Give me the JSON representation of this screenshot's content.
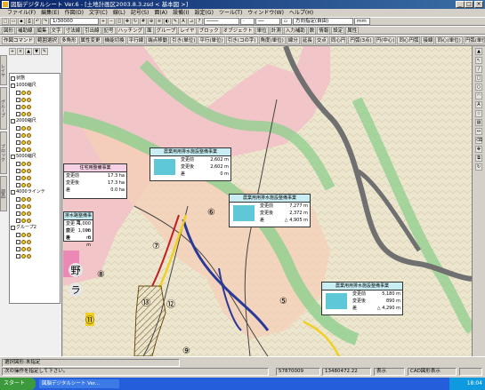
{
  "window": {
    "title": "図脳デジタルシート Ver.6 - [土地計画区2003.8.3.zsd  <  基本図  >]"
  },
  "menu": [
    "ファイル(F)",
    "編集(E)",
    "作図(D)",
    "文字(C)",
    "線(L)",
    "記号(S)",
    "面(A)",
    "設備(I)",
    "設定(G)",
    "ツール(T)",
    "ウィンドウ(W)",
    "ヘルプ(H)"
  ],
  "toolbar1": {
    "scale": "1/30000",
    "direction": "方向指定(自由)",
    "unit": "mm"
  },
  "toolbar2": [
    "図形",
    "補助線",
    "編集",
    "文字",
    "寸法線",
    "引出線",
    "記号",
    "ハッチング",
    "面",
    "グループ",
    "レイヤ",
    "ブロック",
    "オブジェクト",
    "単位",
    "計測",
    "入力補助",
    "数",
    "情報",
    "設定",
    "属性"
  ],
  "toolbar3": [
    "作図コマンド",
    "範囲選択",
    "多角形",
    "属性変更",
    "機能切換",
    "平行線",
    "端点移動",
    "引き(単位)",
    "平行(単位)",
    "引き(コの字)",
    "角度(単位)",
    "線分",
    "延長",
    "交点",
    "同心円",
    "円弧(3点)",
    "円(中心)",
    "同心円弧",
    "接線",
    "同心(単位)",
    "円弧(単位)",
    "同心円(延長)"
  ],
  "panel": {
    "tabs": [
      "レイヤ",
      "グループ",
      "ブロック",
      "部品"
    ],
    "tree": [
      {
        "label": "状態"
      },
      {
        "label": "1000縮尺"
      },
      {
        "label": "2000縮尺"
      },
      {
        "label": "5000縮尺"
      },
      {
        "label": "4000ラインテ"
      },
      {
        "label": "グループ2"
      }
    ]
  },
  "labels": {
    "box1": {
      "title": "住宅用整備事業",
      "rows": [
        [
          "変更前",
          "17.3 ha"
        ],
        [
          "変更後",
          "17.3 ha"
        ],
        [
          "差",
          "0.0 ha"
        ]
      ]
    },
    "box2": {
      "title": "農業用用排水施設整備事業",
      "rows": [
        [
          "変更前",
          "2,602 m"
        ],
        [
          "変更後",
          "2,602 m"
        ],
        [
          "差",
          "0 m"
        ]
      ]
    },
    "box3": {
      "title": "農業用用排水施設整備事業",
      "rows": [
        [
          "変更前",
          "7,277 m"
        ],
        [
          "変更後",
          "2,372 m"
        ],
        [
          "差",
          "△ 4,905 m"
        ]
      ]
    },
    "box4": {
      "title": "農業用用排水施設整備事業",
      "rows": [
        [
          "変更前",
          "5,180 m"
        ],
        [
          "変更後",
          "890 m"
        ],
        [
          "差",
          "△ 4,290 m"
        ]
      ]
    },
    "box5": {
      "title": "排水路整備事業",
      "rows": [
        [
          "変更前",
          "1,000 m"
        ],
        [
          "変更後",
          "1,000 m"
        ],
        [
          "差",
          "0 m"
        ]
      ]
    },
    "circles": [
      "⑤",
      "⑥",
      "⑦",
      "⑧",
      "⑨",
      "⑪",
      "⑫",
      "⑬"
    ],
    "place": [
      "野",
      "ラ"
    ]
  },
  "status": {
    "coord_label": "選択図形:未指定",
    "prompt": "次の操作を指定して下さい。",
    "x": "57870009",
    "y": "13480472.22",
    "grid": "表示",
    "snap": "CAD図形表示"
  },
  "taskbar": {
    "start": "スタート",
    "app": "図脳デジタルシート Ver...",
    "clock": "18:04"
  },
  "colors": {
    "titlebar": "#0a246a",
    "pink_area": "#f2c0c8",
    "green_band": "#8ccf8c",
    "gray_road": "#707070",
    "blue_line": "#2a3a9a",
    "yellow_line": "#f0d020"
  }
}
